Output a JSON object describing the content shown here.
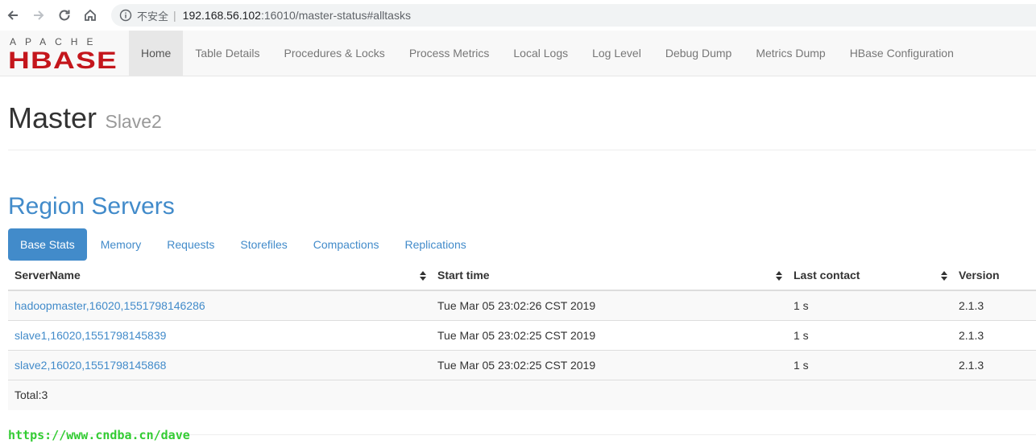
{
  "browser": {
    "insecure_label": "不安全",
    "url_host": "192.168.56.102",
    "url_rest": ":16010/master-status#alltasks"
  },
  "navbar": {
    "logo_top": "APACHE",
    "logo_main": "HBASE",
    "items": [
      {
        "label": "Home",
        "active": true
      },
      {
        "label": "Table Details"
      },
      {
        "label": "Procedures & Locks"
      },
      {
        "label": "Process Metrics"
      },
      {
        "label": "Local Logs"
      },
      {
        "label": "Log Level"
      },
      {
        "label": "Debug Dump"
      },
      {
        "label": "Metrics Dump"
      },
      {
        "label": "HBase Configuration"
      }
    ]
  },
  "header": {
    "title": "Master",
    "subtitle": "Slave2"
  },
  "region_servers": {
    "title": "Region Servers",
    "tabs": [
      {
        "label": "Base Stats",
        "active": true
      },
      {
        "label": "Memory"
      },
      {
        "label": "Requests"
      },
      {
        "label": "Storefiles"
      },
      {
        "label": "Compactions"
      },
      {
        "label": "Replications"
      }
    ],
    "columns": [
      "ServerName",
      "Start time",
      "Last contact",
      "Version"
    ],
    "rows": [
      {
        "server": "hadoopmaster,16020,1551798146286",
        "start": "Tue Mar 05 23:02:26 CST 2019",
        "contact": "1 s",
        "version": "2.1.3"
      },
      {
        "server": "slave1,16020,1551798145839",
        "start": "Tue Mar 05 23:02:25 CST 2019",
        "contact": "1 s",
        "version": "2.1.3"
      },
      {
        "server": "slave2,16020,1551798145868",
        "start": "Tue Mar 05 23:02:25 CST 2019",
        "contact": "1 s",
        "version": "2.1.3"
      }
    ],
    "total": "Total:3"
  },
  "watermark": "https://www.cndba.cn/dave",
  "colors": {
    "accent": "#428bca",
    "logo_red": "#c4161c",
    "watermark": "#33cc33"
  }
}
